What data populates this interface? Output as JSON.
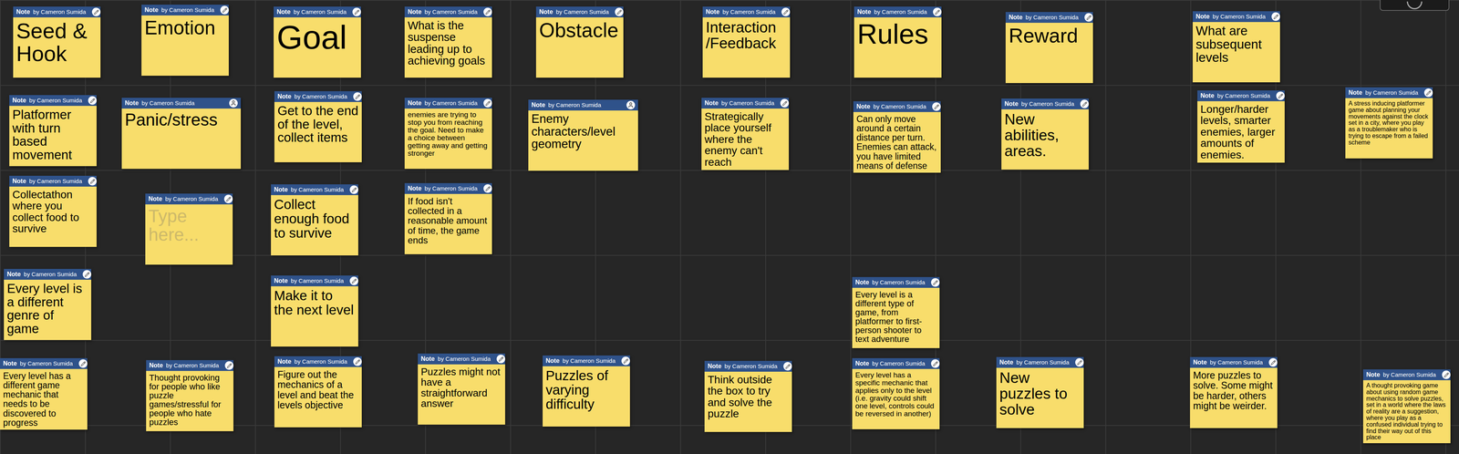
{
  "board": {
    "notes": [
      {
        "label": "Note",
        "author": "by Cameron Sumida",
        "text": "Seed & Hook",
        "placeholder": false,
        "kind": "pencil"
      },
      {
        "label": "Note",
        "author": "by Cameron Sumida",
        "text": "Emotion",
        "placeholder": false,
        "kind": "pencil"
      },
      {
        "label": "Note",
        "author": "by Cameron Sumida",
        "text": "Goal",
        "placeholder": false,
        "kind": "pencil"
      },
      {
        "label": "Note",
        "author": "by Cameron Sumida",
        "text": "What is the suspense leading up to achieving goals",
        "placeholder": false,
        "kind": "pencil"
      },
      {
        "label": "Note",
        "author": "by Cameron Sumida",
        "text": "Obstacle",
        "placeholder": false,
        "kind": "pencil"
      },
      {
        "label": "Note",
        "author": "by Cameron Sumida",
        "text": "Interaction /Feedback",
        "placeholder": false,
        "kind": "pencil"
      },
      {
        "label": "Note",
        "author": "by Cameron Sumida",
        "text": "Rules",
        "placeholder": false,
        "kind": "pencil"
      },
      {
        "label": "Note",
        "author": "by Cameron Sumida",
        "text": "Reward",
        "placeholder": false,
        "kind": "pencil"
      },
      {
        "label": "Note",
        "author": "by Cameron Sumida",
        "text": "What are subsequent levels",
        "placeholder": false,
        "kind": "pencil"
      },
      {
        "label": "Note",
        "author": "by Cameron Sumida",
        "text": "Platformer with turn based movement",
        "placeholder": false,
        "kind": "pencil"
      },
      {
        "label": "Note",
        "author": "by Cameron Sumida",
        "text": "Panic/stress",
        "placeholder": false,
        "kind": "avatar"
      },
      {
        "label": "Note",
        "author": "by Cameron Sumida",
        "text": "Get to the end of the level, collect items",
        "placeholder": false,
        "kind": "pencil"
      },
      {
        "label": "Note",
        "author": "by Cameron Sumida",
        "text": "enemies are trying to stop you from reaching the goal. Need to make a choice between getting away and getting stronger",
        "placeholder": false,
        "kind": "pencil"
      },
      {
        "label": "Note",
        "author": "by Cameron Sumida",
        "text": "Enemy characters/level geometry",
        "placeholder": false,
        "kind": "avatar"
      },
      {
        "label": "Note",
        "author": "by Cameron Sumida",
        "text": "Strategically place yourself where the enemy can't reach",
        "placeholder": false,
        "kind": "pencil"
      },
      {
        "label": "Note",
        "author": "by Cameron Sumida",
        "text": "Can only move around a certain distance per turn. Enemies can attack, you have limited means of defense",
        "placeholder": false,
        "kind": "pencil"
      },
      {
        "label": "Note",
        "author": "by Cameron Sumida",
        "text": "New abilities, areas.",
        "placeholder": false,
        "kind": "pencil"
      },
      {
        "label": "Note",
        "author": "by Cameron Sumida",
        "text": "Longer/harder levels, smarter enemies, larger amounts of enemies.",
        "placeholder": false,
        "kind": "pencil"
      },
      {
        "label": "Note",
        "author": "by Cameron Sumida",
        "text": "A stress inducing platformer game about planning your movements against the clock set in a city, where you play as a troublemaker who is trying to escape from a failed scheme",
        "placeholder": false,
        "kind": "pencil"
      },
      {
        "label": "Note",
        "author": "by Cameron Sumida",
        "text": "Collectathon where you collect food to survive",
        "placeholder": false,
        "kind": "pencil"
      },
      {
        "label": "Note",
        "author": "by Cameron Sumida",
        "text": "Type here...",
        "placeholder": true,
        "kind": "pencil"
      },
      {
        "label": "Note",
        "author": "by Cameron Sumida",
        "text": "Collect enough food to survive",
        "placeholder": false,
        "kind": "pencil"
      },
      {
        "label": "Note",
        "author": "by Cameron Sumida",
        "text": "If food isn't collected in a reasonable amount of time, the game ends",
        "placeholder": false,
        "kind": "pencil"
      },
      {
        "label": "Note",
        "author": "by Cameron Sumida",
        "text": "Every level is a different genre of game",
        "placeholder": false,
        "kind": "pencil"
      },
      {
        "label": "Note",
        "author": "by Cameron Sumida",
        "text": "Make it to the next level",
        "placeholder": false,
        "kind": "pencil"
      },
      {
        "label": "Note",
        "author": "by Cameron Sumida",
        "text": "Every level is a different type of game, from platformer to first-person shooter to text adventure",
        "placeholder": false,
        "kind": "pencil"
      },
      {
        "label": "Note",
        "author": "by Cameron Sumida",
        "text": "Every level has a different game mechanic that needs to be discovered to progress",
        "placeholder": false,
        "kind": "pencil"
      },
      {
        "label": "Note",
        "author": "by Cameron Sumida",
        "text": "Thought provoking for people who like puzzle games/stressful for people who hate puzzles",
        "placeholder": false,
        "kind": "pencil"
      },
      {
        "label": "Note",
        "author": "by Cameron Sumida",
        "text": "Figure out the mechanics of a level and beat the levels objective",
        "placeholder": false,
        "kind": "pencil"
      },
      {
        "label": "Note",
        "author": "by Cameron Sumida",
        "text": "Puzzles might not have a straightforward answer",
        "placeholder": false,
        "kind": "pencil"
      },
      {
        "label": "Note",
        "author": "by Cameron Sumida",
        "text": "Puzzles of varying difficulty",
        "placeholder": false,
        "kind": "pencil"
      },
      {
        "label": "Note",
        "author": "by Cameron Sumida",
        "text": "Think outside the box to try and solve the puzzle",
        "placeholder": false,
        "kind": "pencil"
      },
      {
        "label": "Note",
        "author": "by Cameron Sumida",
        "text": "Every level has a specific mechanic that applies only to the level (i.e. gravity could shift one level, controls could be reversed in another)",
        "placeholder": false,
        "kind": "pencil"
      },
      {
        "label": "Note",
        "author": "by Cameron Sumida",
        "text": "New puzzles to solve",
        "placeholder": false,
        "kind": "pencil"
      },
      {
        "label": "Note",
        "author": "by Cameron Sumida",
        "text": "More puzzles to solve. Some might be harder, others might be weirder.",
        "placeholder": false,
        "kind": "pencil"
      },
      {
        "label": "Note",
        "author": "by Cameron Sumida",
        "text": "A thought provoking game about using random game mechanics to solve puzzles, set in a world where the laws of reality are a suggestion, where you play as a confused individual trying to find their way out of this place",
        "placeholder": false,
        "kind": "pencil"
      }
    ]
  }
}
